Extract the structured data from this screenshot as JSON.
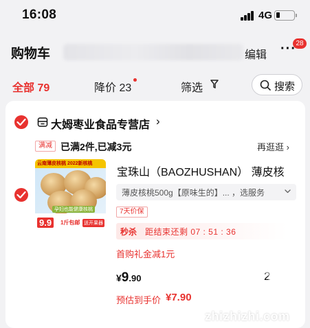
{
  "status_bar": {
    "time": "16:08",
    "network": "4G"
  },
  "header": {
    "title": "购物车",
    "edit_label": "编辑",
    "more_label": "···",
    "badge": "28"
  },
  "filters": {
    "all_label": "全部 79",
    "price_drop_label": "降价 23",
    "filter_label": "筛选",
    "search_label": "搜索"
  },
  "store": {
    "name": "大姆枣业食品专营店",
    "arrow": "›",
    "promo_tag": "满减",
    "promo_text": "已满2件,已减3元",
    "shop_more": "再逛逛 ›"
  },
  "product": {
    "title": "宝珠山（BAOZHUSHAN） 薄皮核",
    "sku": "薄皮核桃500g【原味生的】... ，选服务",
    "return_tag": "7天价保",
    "flash_label": "秒杀",
    "flash_countdown": "距结束还剩 07 : 51 : 36",
    "coupon": "首购礼金减1元",
    "price_currency": "¥",
    "price_int": "9",
    "price_dec": ".90",
    "qty": "2",
    "est_label": "预估到手价",
    "est_price": "¥7.90",
    "image": {
      "banner": "云南薄皮核桃 2022新核桃",
      "label": "孕妇也能健康核桃",
      "price": "9.9",
      "ship": "1斤包邮",
      "gift": "送开果器"
    }
  },
  "watermark": {
    "text": "zhizhizhi.com"
  },
  "colors": {
    "accent": "#e8322f",
    "background": "#f2f2f4",
    "card": "#ffffff"
  }
}
